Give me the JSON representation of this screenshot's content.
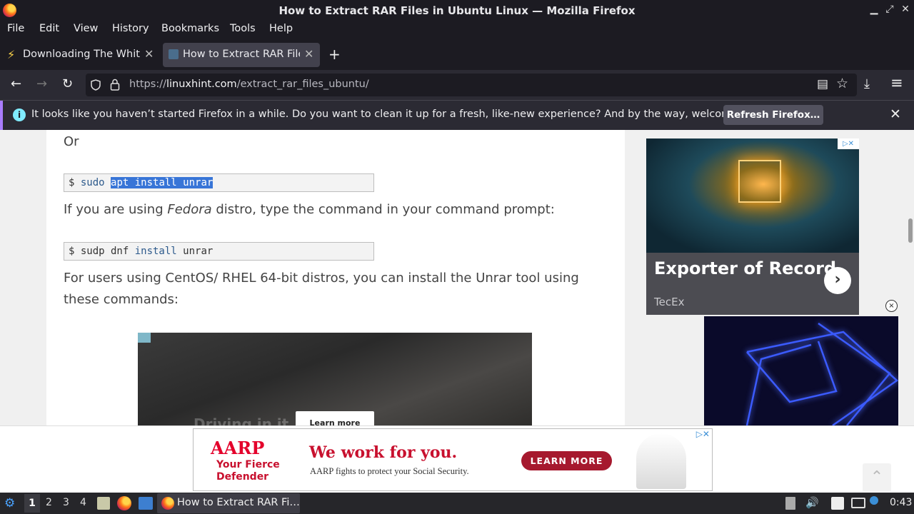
{
  "window": {
    "title": "How to Extract RAR Files in Ubuntu Linux — Mozilla Firefox",
    "controls": {
      "minimize": "▁",
      "restore": "⤢",
      "close": "✕"
    }
  },
  "menu": [
    "File",
    "Edit",
    "View",
    "History",
    "Bookmarks",
    "Tools",
    "Help"
  ],
  "tabs": [
    {
      "label": "Downloading The White H",
      "close": "✕"
    },
    {
      "label": "How to Extract RAR Files",
      "close": "✕"
    }
  ],
  "new_tab": "+",
  "nav": {
    "back": "←",
    "forward": "→",
    "reload": "↻",
    "url_prefix": "https://",
    "url_domain": "linuxhint.com",
    "url_path": "/extract_rar_files_ubuntu/",
    "download": "⤓",
    "menu": "≡",
    "reader": "▤",
    "bookmark": "☆"
  },
  "notification": {
    "message": "It looks like you haven’t started Firefox in a while. Do you want to clean it up for a fresh, like-new experience? And by the way, welcome back!",
    "button": "Refresh Firefox…",
    "close": "✕",
    "info": "i"
  },
  "article": {
    "or": "Or",
    "code1": {
      "prompt": "$ ",
      "plain": "sudo ",
      "selected": "apt install unrar"
    },
    "fedora_pre": "If you are using ",
    "fedora_em": "Fedora",
    "fedora_post": " distro, type the command in your command prompt:",
    "code2": {
      "prompt": "$ ",
      "part1": "sudp dnf ",
      "kw": "install",
      "part2": " unrar"
    },
    "centos_line1": "For users using CentOS/ RHEL 64-bit distros, you can install the Unrar tool using",
    "centos_line2": "these commands:",
    "video_button": "Learn more",
    "video_caption": "Driving in it"
  },
  "side_ad": {
    "headline": "Exporter of Record",
    "brand": "TecEx",
    "arrow": "›",
    "badge": "▷✕"
  },
  "close_ad": "×",
  "bottom_ad": {
    "logo": "AARP",
    "tag_line1": "Your Fierce",
    "tag_line2": "Defender",
    "headline": "We work  for you.",
    "sub": "AARP fights to protect your Social Security.",
    "cta": "LEARN MORE",
    "badge": "▷✕"
  },
  "scroll_top": "⌃",
  "taskbar": {
    "workspaces": [
      "1",
      "2",
      "3",
      "4"
    ],
    "task_label": "How to Extract RAR Fi…",
    "clock": "0:43",
    "volume": "🔊"
  }
}
